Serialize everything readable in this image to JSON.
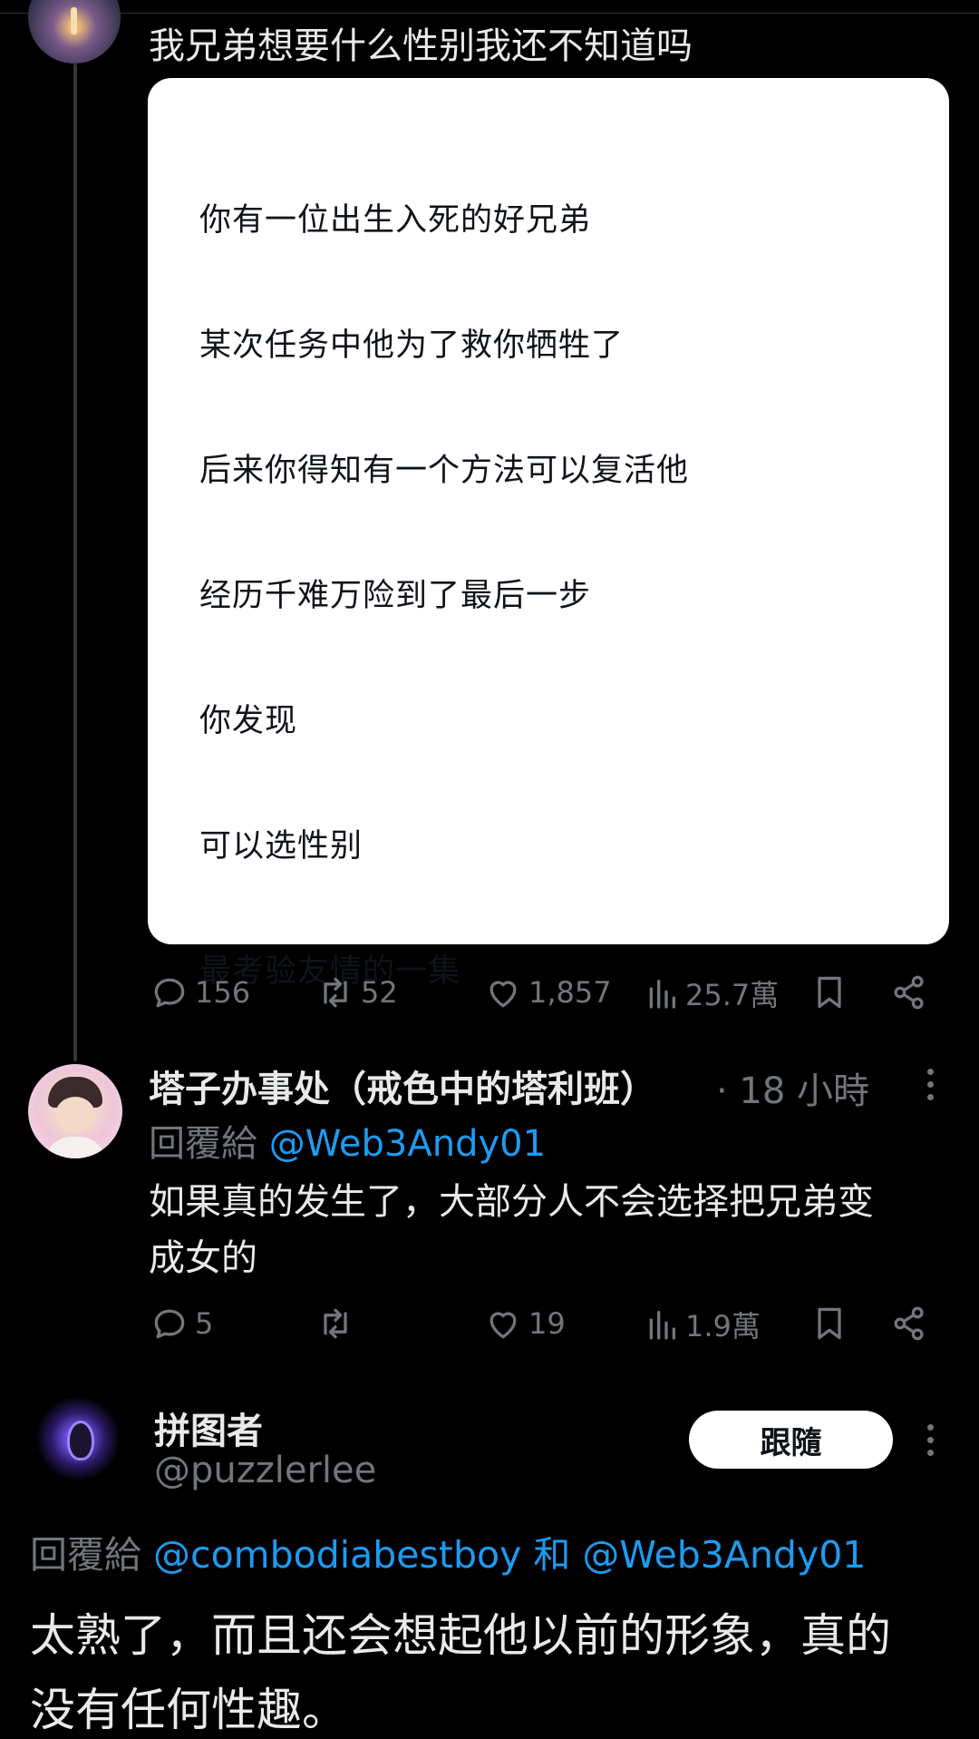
{
  "post1": {
    "body": "我兄弟想要什么性别我还不知道吗",
    "card_lines": [
      "你有一位出生入死的好兄弟",
      "某次任务中他为了救你牺牲了",
      "后来你得知有一个方法可以复活他",
      "经历千难万险到了最后一步",
      "你发现",
      "可以选性别",
      "最考验友情的一集"
    ],
    "stats": {
      "replies": "156",
      "reposts": "52",
      "likes": "1,857",
      "views": "25.7萬"
    }
  },
  "post2": {
    "name": "塔子办事处（戒色中的塔利班）",
    "time": "· 18 小時",
    "reply_prefix": "回覆給",
    "reply_to": "@Web3Andy01",
    "body_line1": "如果真的发生了，大部分人不会选择把兄弟变",
    "body_line2": "成女的",
    "stats": {
      "replies": "5",
      "reposts": "",
      "likes": "19",
      "views": "1.9萬"
    }
  },
  "post3": {
    "name": "拼图者",
    "handle": "@puzzlerlee",
    "follow_label": "跟隨",
    "reply_prefix": "回覆給",
    "reply_to_1": "@combodiabestboy",
    "reply_and": "和",
    "reply_to_2": "@Web3Andy01",
    "body_line1": "太熟了，而且还会想起他以前的形象，真的",
    "body_line2": "没有任何性趣。"
  },
  "colors": {
    "accent": "#1d9bf0",
    "muted": "#71767b",
    "text": "#e7e9ea"
  }
}
